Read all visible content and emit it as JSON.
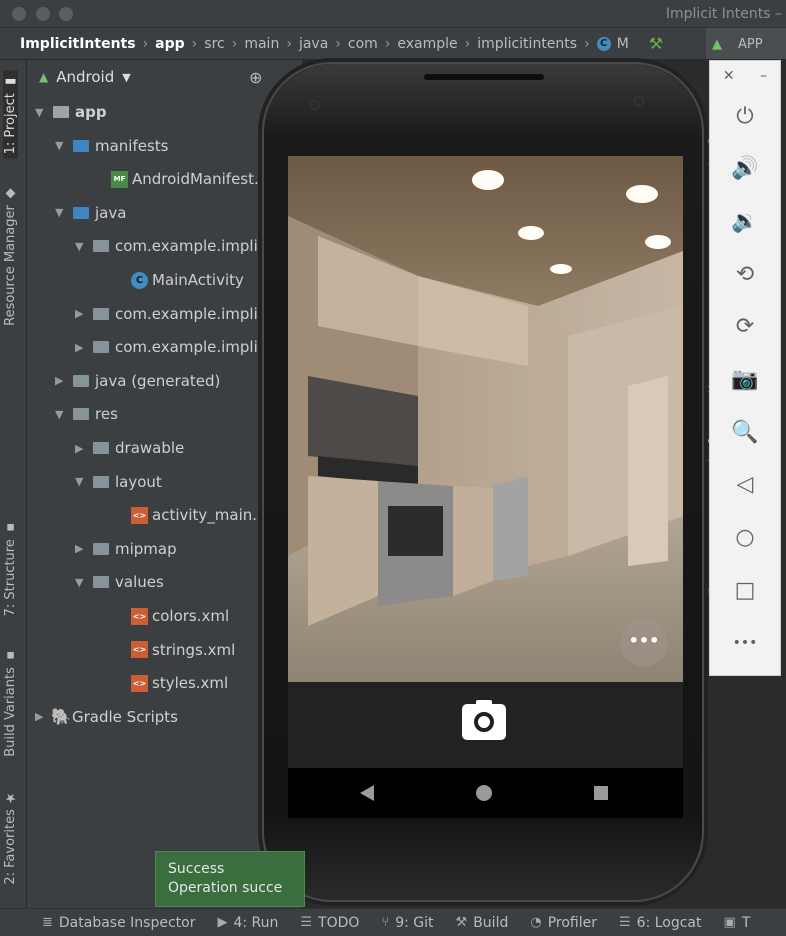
{
  "window": {
    "title": "Implicit Intents –"
  },
  "breadcrumbs": [
    "ImplicitIntents",
    "app",
    "src",
    "main",
    "java",
    "com",
    "example",
    "implicitintents",
    "M"
  ],
  "nav_right": {
    "run_tab": "APP"
  },
  "left_tabs": {
    "project": "1: Project",
    "resource_manager": "Resource Manager",
    "structure": "7: Structure",
    "build_variants": "Build Variants",
    "favorites": "2: Favorites"
  },
  "project_panel": {
    "view_mode": "Android",
    "tree": [
      {
        "label": "app",
        "level": 0,
        "kind": "module",
        "expanded": true
      },
      {
        "label": "manifests",
        "level": 1,
        "kind": "folder-blue",
        "expanded": true
      },
      {
        "label": "AndroidManifest.xml",
        "level": 2,
        "kind": "manifest"
      },
      {
        "label": "java",
        "level": 1,
        "kind": "folder-blue",
        "expanded": true
      },
      {
        "label": "com.example.implicitintents",
        "level": 2,
        "kind": "package",
        "expanded": true
      },
      {
        "label": "MainActivity",
        "level": 3,
        "kind": "class"
      },
      {
        "label": "com.example.implicitintents",
        "level": 2,
        "kind": "package",
        "expanded": false
      },
      {
        "label": "com.example.implicitintents",
        "level": 2,
        "kind": "package",
        "expanded": false
      },
      {
        "label": "java (generated)",
        "level": 1,
        "kind": "folder-gen",
        "expanded": false
      },
      {
        "label": "res",
        "level": 1,
        "kind": "folder-res",
        "expanded": true
      },
      {
        "label": "drawable",
        "level": 2,
        "kind": "folder",
        "expanded": false
      },
      {
        "label": "layout",
        "level": 2,
        "kind": "folder",
        "expanded": true
      },
      {
        "label": "activity_main.xml",
        "level": 3,
        "kind": "xml"
      },
      {
        "label": "mipmap",
        "level": 2,
        "kind": "folder",
        "expanded": false
      },
      {
        "label": "values",
        "level": 2,
        "kind": "folder",
        "expanded": true
      },
      {
        "label": "colors.xml",
        "level": 3,
        "kind": "xml"
      },
      {
        "label": "strings.xml",
        "level": 3,
        "kind": "xml"
      },
      {
        "label": "styles.xml",
        "level": 3,
        "kind": "xml"
      },
      {
        "label": "Gradle Scripts",
        "level": 0,
        "kind": "gradle",
        "expanded": false
      }
    ]
  },
  "emulator_toolbar": {
    "buttons": [
      "power-icon",
      "volume-up-icon",
      "volume-down-icon",
      "rotate-left-icon",
      "rotate-right-icon",
      "camera-icon",
      "zoom-icon",
      "back-icon",
      "home-icon",
      "overview-icon",
      "more-icon"
    ]
  },
  "notification": {
    "title": "Success",
    "message": "Operation succe"
  },
  "bottom_tabs": [
    {
      "label": "Database Inspector",
      "icon": "database-icon"
    },
    {
      "label": "4: Run",
      "icon": "run-icon"
    },
    {
      "label": "TODO",
      "icon": "todo-icon"
    },
    {
      "label": "9: Git",
      "icon": "git-icon"
    },
    {
      "label": "Build",
      "icon": "build-icon"
    },
    {
      "label": "Profiler",
      "icon": "profiler-icon"
    },
    {
      "label": "6: Logcat",
      "icon": "logcat-icon"
    },
    {
      "label": "T",
      "icon": "terminal-icon"
    }
  ],
  "colors": {
    "ide_bg": "#3c3f41",
    "editor_bg": "#2b2b2b",
    "toast_bg": "#3b6e3e",
    "android_green": "#77c36d"
  }
}
